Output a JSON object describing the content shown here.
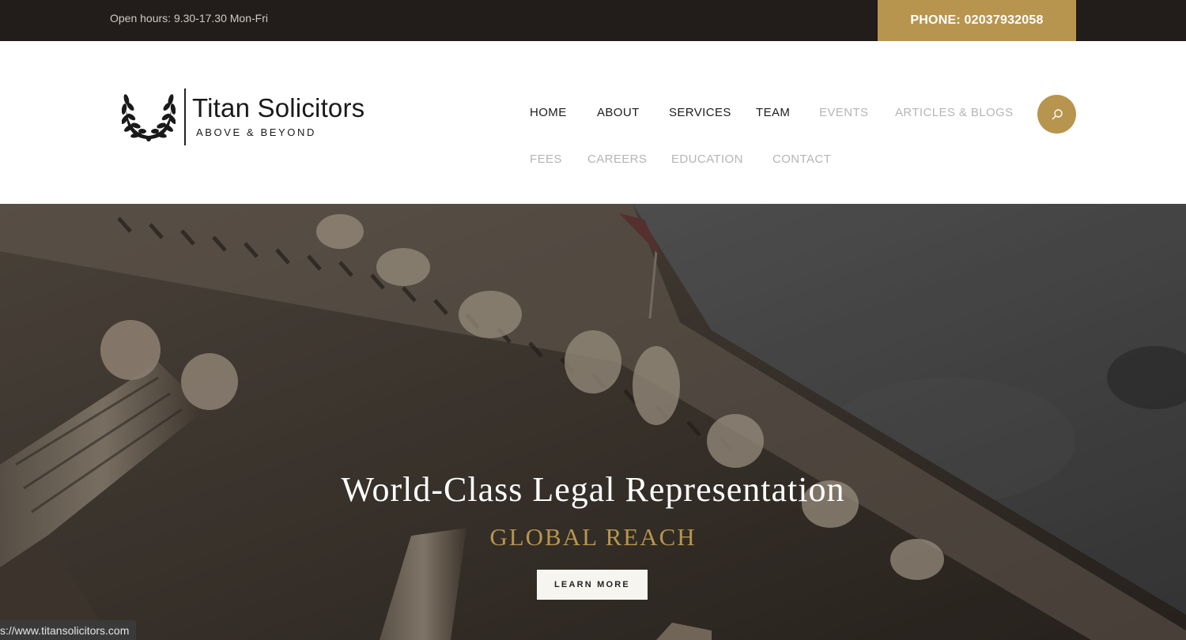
{
  "topbar": {
    "open_hours": "Open hours: 9.30-17.30 Mon-Fri",
    "phone": "PHONE: 02037932058"
  },
  "logo": {
    "name": "Titan Solicitors",
    "tagline": "ABOVE & BEYOND",
    "icon": "laurel-wreath-icon"
  },
  "nav": {
    "row1": [
      "HOME",
      "ABOUT",
      "SERVICES",
      "TEAM",
      "EVENTS",
      "ARTICLES & BLOGS"
    ],
    "row2": [
      "FEES",
      "CAREERS",
      "EDUCATION",
      "CONTACT"
    ],
    "search_icon": "search-icon"
  },
  "hero": {
    "headline": "World-Class Legal Representation",
    "subline": "GLOBAL REACH",
    "button": "LEARN MORE"
  },
  "status_url": "s://www.titansolicitors.com",
  "colors": {
    "topbar_bg": "#221d1b",
    "accent_gold": "#b8954e",
    "nav_dark": "#1c1c1c",
    "nav_light": "#b5b5b5"
  }
}
